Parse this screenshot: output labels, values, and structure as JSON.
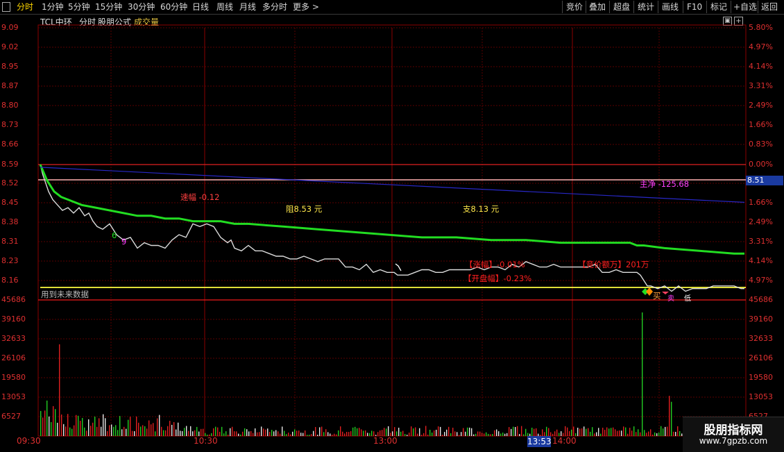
{
  "toolbar": {
    "periods": [
      "分时",
      "1分钟",
      "5分钟",
      "15分钟",
      "30分钟",
      "60分钟",
      "日线",
      "周线",
      "月线",
      "多分时",
      "更多 >"
    ],
    "active_period": "分时",
    "right_buttons": [
      "竞价",
      "叠加",
      "超盘",
      "统计",
      "画线",
      "F10",
      "标记",
      "+自选",
      "返回"
    ]
  },
  "chart_header": {
    "stock_name": "TCL中环",
    "mode": "分时",
    "formula": "股朋公式",
    "indicator": "成交量"
  },
  "price_axis_left": [
    "9.09",
    "9.02",
    "8.95",
    "8.87",
    "8.80",
    "8.73",
    "8.66",
    "8.59",
    "8.52",
    "8.45",
    "8.38",
    "8.31",
    "8.23",
    "8.16"
  ],
  "pct_axis_right": [
    "5.80%",
    "4.97%",
    "4.14%",
    "3.31%",
    "2.49%",
    "1.66%",
    "0.83%",
    "0.00%",
    "",
    "1.66%",
    "2.49%",
    "3.31%",
    "4.14%",
    "4.97%"
  ],
  "current_price_tag": "8.51",
  "volume_axis": [
    "45686",
    "39160",
    "32633",
    "26106",
    "19580",
    "13053",
    "6527"
  ],
  "volume_axis_right_bottom": "6527",
  "time_axis": [
    "09:30",
    "10:30",
    "13:00",
    "14:00"
  ],
  "cursor_time": "13:53",
  "annotations": {
    "speed": "速幅 -0.12",
    "resistance": "阻8.53 元",
    "support": "支8.13 元",
    "main_net": "主净 -125.68",
    "limit_up": "【涨幅】-0.01%",
    "open_amp": "【开盘幅】-0.23%",
    "auction_amount": "【竞价额万】201万",
    "future_data": "用到未来数据",
    "buy": "买",
    "sell": "卖",
    "low": "低",
    "num6": "6",
    "num9": "9"
  },
  "chart_data": {
    "type": "line",
    "price_range": [
      8.16,
      9.09
    ],
    "volume_range": [
      0,
      45686
    ],
    "series": [
      {
        "name": "",
        "color": "#dcdcdc",
        "x": [
          0,
          2,
          4,
          8,
          12,
          18,
          25,
          32,
          40,
          48,
          56,
          64,
          70,
          76,
          82,
          90,
          100,
          110,
          120,
          130,
          140,
          150,
          160,
          170,
          180,
          190,
          200,
          210,
          220,
          230,
          240,
          250,
          260,
          270,
          275,
          280,
          290,
          300,
          310,
          320,
          330,
          340,
          350,
          360,
          370,
          380,
          390,
          400,
          410,
          420,
          430,
          440,
          450,
          460,
          470,
          480,
          490,
          500,
          510,
          515,
          520,
          530,
          540,
          550,
          560,
          570,
          580,
          590,
          600,
          610,
          620,
          630,
          640,
          650,
          660,
          670,
          680,
          690,
          700,
          710,
          720,
          730,
          740,
          750,
          760,
          770,
          780,
          790,
          800,
          810,
          820,
          830,
          840,
          850,
          860,
          865,
          870,
          875,
          880,
          890,
          900,
          910,
          920,
          930,
          940,
          950,
          960,
          970,
          980,
          990,
          1000,
          1010,
          1015
        ],
        "y": [
          8.59,
          8.57,
          8.55,
          8.52,
          8.49,
          8.46,
          8.44,
          8.42,
          8.43,
          8.41,
          8.43,
          8.4,
          8.41,
          8.38,
          8.36,
          8.35,
          8.37,
          8.33,
          8.31,
          8.32,
          8.28,
          8.3,
          8.29,
          8.29,
          8.28,
          8.31,
          8.33,
          8.32,
          8.37,
          8.36,
          8.37,
          8.36,
          8.32,
          8.3,
          8.31,
          8.28,
          8.27,
          8.29,
          8.27,
          8.27,
          8.26,
          8.25,
          8.25,
          8.24,
          8.24,
          8.25,
          8.24,
          8.23,
          8.24,
          8.24,
          8.24,
          8.21,
          8.21,
          8.2,
          8.22,
          8.19,
          8.2,
          8.19,
          8.19,
          8.18,
          8.18,
          8.18,
          8.19,
          8.2,
          8.2,
          8.19,
          8.19,
          8.2,
          8.2,
          8.2,
          8.2,
          8.21,
          8.2,
          8.21,
          8.21,
          8.2,
          8.22,
          8.21,
          8.23,
          8.22,
          8.21,
          8.21,
          8.22,
          8.21,
          8.21,
          8.21,
          8.21,
          8.21,
          8.22,
          8.19,
          8.19,
          8.2,
          8.19,
          8.19,
          8.19,
          8.18,
          8.16,
          8.14,
          8.14,
          8.13,
          8.14,
          8.12,
          8.14,
          8.12,
          8.13,
          8.13,
          8.13,
          8.14,
          8.14,
          8.14,
          8.14,
          8.13,
          8.13
        ]
      },
      {
        "name": "",
        "color": "#22dd22",
        "x": [
          0,
          10,
          20,
          30,
          40,
          60,
          80,
          100,
          120,
          140,
          160,
          180,
          200,
          220,
          240,
          260,
          280,
          300,
          350,
          400,
          450,
          500,
          550,
          600,
          650,
          700,
          750,
          800,
          850,
          860,
          870,
          900,
          950,
          1000,
          1015
        ],
        "y": [
          8.59,
          8.53,
          8.49,
          8.47,
          8.46,
          8.44,
          8.43,
          8.42,
          8.41,
          8.4,
          8.4,
          8.39,
          8.39,
          8.38,
          8.38,
          8.38,
          8.37,
          8.37,
          8.36,
          8.35,
          8.34,
          8.33,
          8.32,
          8.32,
          8.31,
          8.31,
          8.3,
          8.3,
          8.3,
          8.29,
          8.29,
          8.28,
          8.27,
          8.26,
          8.26
        ]
      },
      {
        "name": "",
        "color": "#2828c8",
        "x": [
          0,
          1015
        ],
        "y": [
          8.58,
          8.45
        ]
      }
    ],
    "reference_lines": {
      "open_price": 8.59,
      "upper_pink": 8.51,
      "yellow": 8.16
    },
    "volume_bars_note": "per-minute volume bars, red/green/white"
  }
}
